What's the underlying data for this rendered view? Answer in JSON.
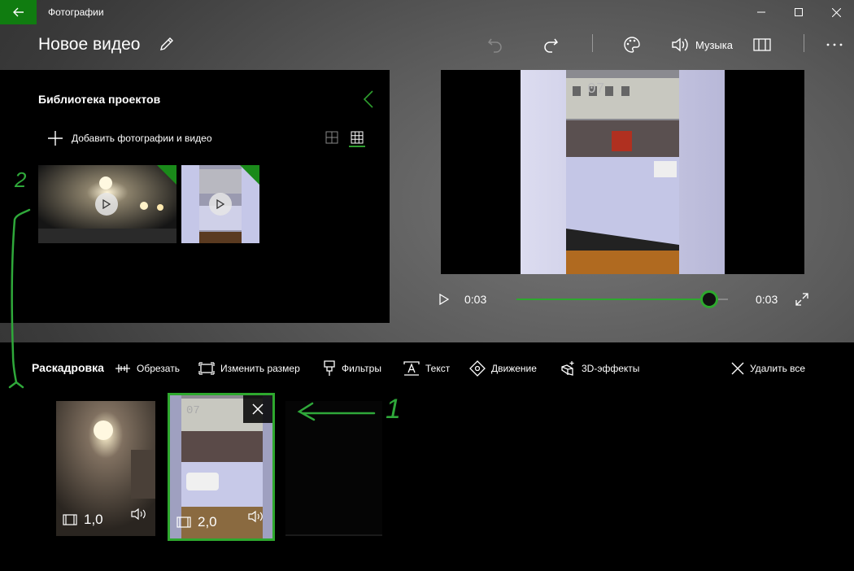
{
  "window": {
    "app_title": "Фотографии"
  },
  "header": {
    "project_title": "Новое видео",
    "music_label": "Музыка"
  },
  "library": {
    "title": "Библиотека проектов",
    "add_label": "Добавить фотографии и видео"
  },
  "playback": {
    "current_time": "0:03",
    "total_time": "0:03",
    "progress": 0.91
  },
  "storyboard": {
    "title": "Раскадровка",
    "tools": [
      {
        "label": "Обрезать",
        "icon": "trim-icon"
      },
      {
        "label": "Изменить размер",
        "icon": "resize-icon"
      },
      {
        "label": "Фильтры",
        "icon": "filters-icon"
      },
      {
        "label": "Текст",
        "icon": "text-icon"
      },
      {
        "label": "Движение",
        "icon": "motion-icon"
      },
      {
        "label": "3D-эффекты",
        "icon": "3d-effects-icon"
      }
    ],
    "remove_all_label": "Удалить все",
    "clips": [
      {
        "duration": "1,0"
      },
      {
        "duration": "2,0"
      }
    ]
  },
  "annotations": {
    "label_1": "1",
    "label_2": "2"
  },
  "colors": {
    "accent": "#107c10",
    "seek": "#2ea82e",
    "annotation": "#2fa83a"
  }
}
